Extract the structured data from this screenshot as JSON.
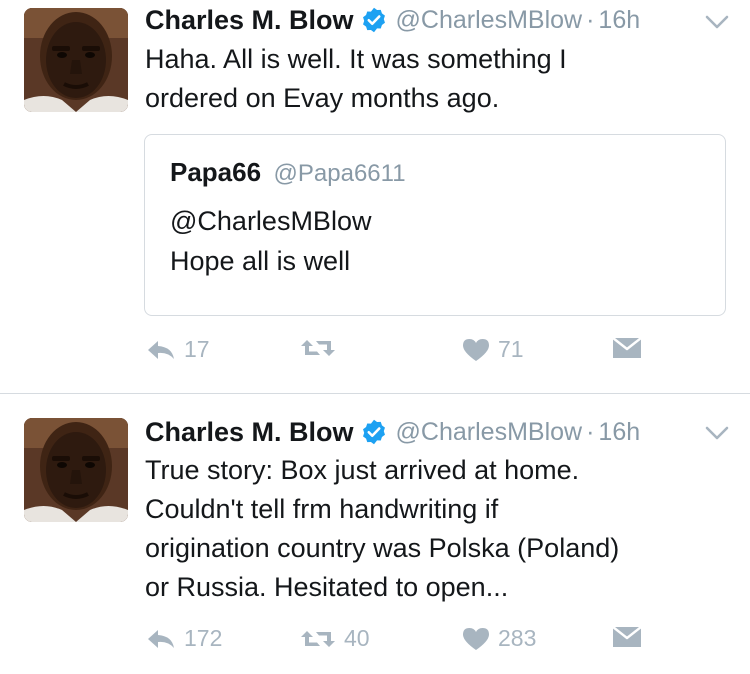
{
  "tweets": [
    {
      "author_name": "Charles M. Blow",
      "handle": "@CharlesMBlow",
      "separator": "·",
      "time": "16h",
      "text_lines": [
        "Haha. All is well. It was something I",
        "ordered on Evay months ago."
      ],
      "quoted": {
        "name": "Papa66",
        "handle": "@Papa6611",
        "text_lines": [
          "@CharlesMBlow",
          "Hope all is well"
        ]
      },
      "actions": {
        "replies": "17",
        "retweets": "",
        "likes": "71"
      }
    },
    {
      "author_name": "Charles M. Blow",
      "handle": "@CharlesMBlow",
      "separator": "·",
      "time": "16h",
      "text_lines": [
        "True story: Box just arrived at home.",
        "Couldn't tell frm handwriting if",
        "origination country was Polska (Poland)",
        "or Russia. Hesitated to open..."
      ],
      "actions": {
        "replies": "172",
        "retweets": "40",
        "likes": "283"
      }
    }
  ],
  "icons": {
    "verified": "verified-badge-icon",
    "caret": "chevron-down-icon",
    "reply": "reply-icon",
    "retweet": "retweet-icon",
    "like": "heart-icon",
    "dm": "direct-message-icon"
  },
  "colors": {
    "text": "#14171a",
    "secondary": "#8899a6",
    "action_gray": "#a8b5c0",
    "verified_blue": "#1da1f2",
    "border": "#d6dbe0"
  }
}
